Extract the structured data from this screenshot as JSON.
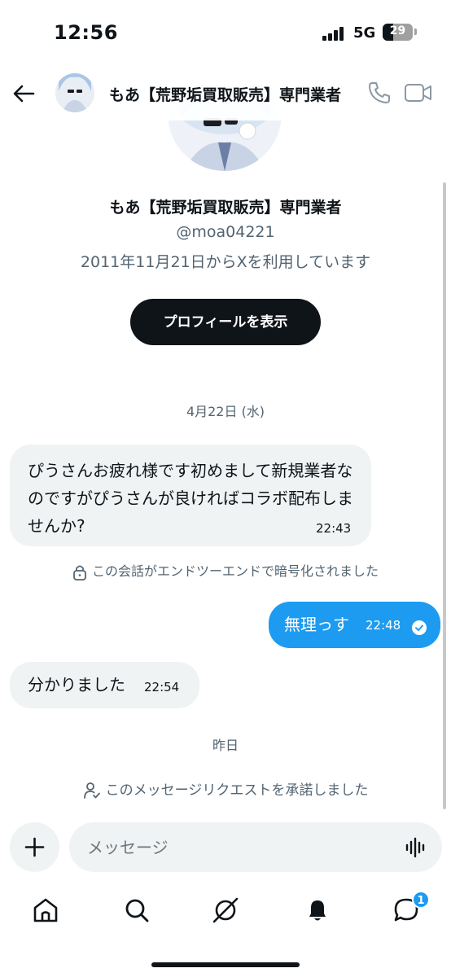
{
  "status_bar": {
    "time": "12:56",
    "network": "5G",
    "battery": "29"
  },
  "header": {
    "name": "もあ【荒野垢買取販売】専門業者"
  },
  "profile": {
    "name": "もあ【荒野垢買取販売】専門業者",
    "handle": "@moa04221",
    "joined": "2011年11月21日からXを利用しています",
    "view_button": "プロフィールを表示"
  },
  "conversation": {
    "date1": "4月22日 (水)",
    "msg1": {
      "text": "ぴうさんお疲れ様です初めまして新規業者なのですがぴうさんが良ければコラボ配布しませんか?",
      "time": "22:43"
    },
    "encryption_note": "この会話がエンドツーエンドで暗号化されました",
    "msg2": {
      "text": "無理っす",
      "time": "22:48"
    },
    "msg3": {
      "text": "分かりました",
      "time": "22:54"
    },
    "date2": "昨日",
    "accept_note": "このメッセージリクエストを承諾しました"
  },
  "composer": {
    "placeholder": "メッセージ"
  },
  "nav": {
    "messages_badge": "1"
  },
  "colors": {
    "accent": "#1d9bf0",
    "text": "#0f1419",
    "muted": "#536471",
    "bubble_in": "#eff3f4"
  }
}
